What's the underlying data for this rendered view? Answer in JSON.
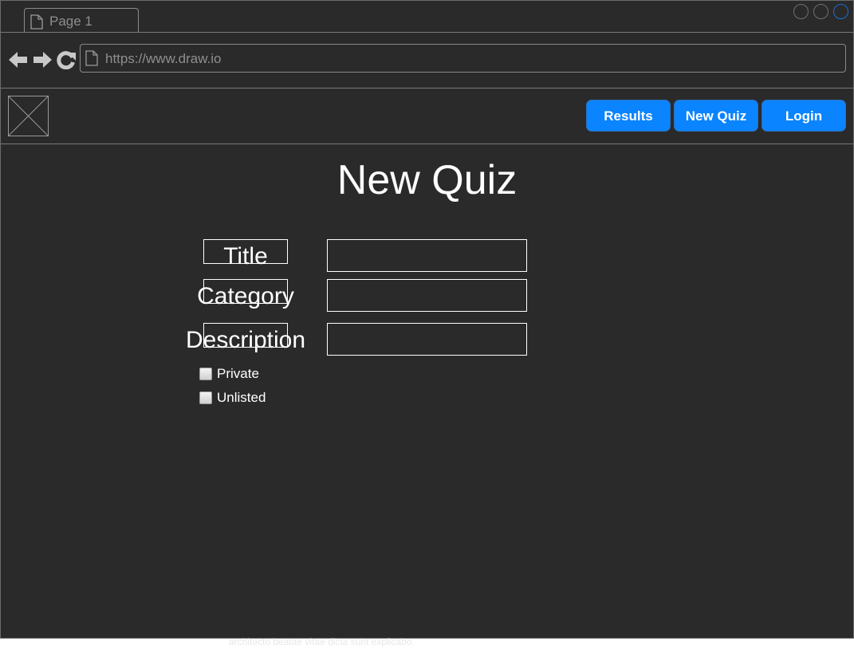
{
  "browser": {
    "tab_label": "Page 1",
    "url": "https://www.draw.io"
  },
  "header": {
    "nav_buttons": [
      "Results",
      "New Quiz",
      "Login"
    ]
  },
  "main": {
    "title": "New Quiz",
    "form": {
      "fields": [
        {
          "label": "Title",
          "value": ""
        },
        {
          "label": "Category",
          "value": ""
        },
        {
          "label": "Description",
          "value": ""
        }
      ],
      "checkboxes": [
        {
          "label": "Private",
          "checked": false
        },
        {
          "label": "Unlisted",
          "checked": false
        }
      ]
    }
  },
  "footer": {
    "text": "architecto beatae vitae dicta sunt explicabo."
  },
  "colors": {
    "background": "#2a2a2a",
    "accent": "#0a84ff",
    "active_window_control": "#1c6fd1"
  },
  "icons": [
    "document-icon",
    "back-arrow-icon",
    "forward-arrow-icon",
    "reload-icon",
    "image-placeholder-icon"
  ]
}
